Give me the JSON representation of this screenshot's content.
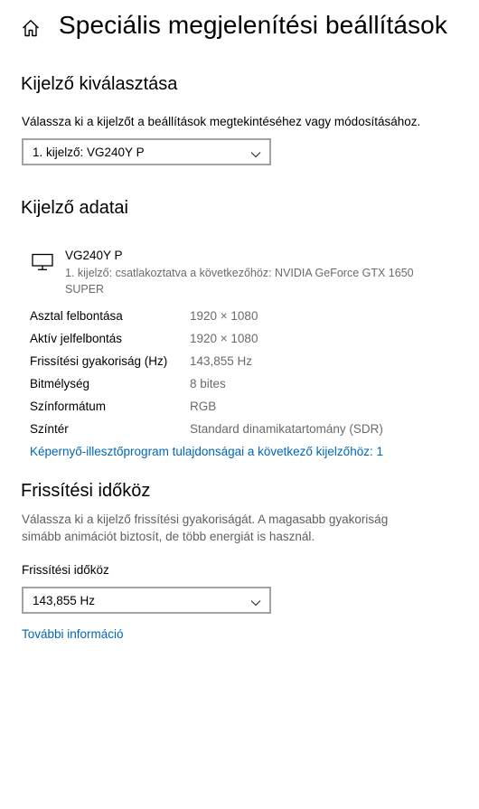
{
  "header": {
    "title": "Speciális megjelenítési beállítások",
    "home_icon": "home-icon"
  },
  "choose_display": {
    "heading": "Kijelző kiválasztása",
    "description": "Válassza ki a kijelzőt a beállítások megtekintéséhez vagy módosításához.",
    "selected": "1. kijelző: VG240Y P"
  },
  "display_info": {
    "heading": "Kijelző adatai",
    "device_icon": "monitor-icon",
    "device_name": "VG240Y P",
    "device_description": "1. kijelző: csatlakoztatva a következőhöz: NVIDIA GeForce GTX 1650 SUPER",
    "properties": [
      {
        "label": "Asztal felbontása",
        "value": "1920 × 1080"
      },
      {
        "label": "Aktív jelfelbontás",
        "value": "1920 × 1080"
      },
      {
        "label": "Frissítési gyakoriság (Hz)",
        "value": "143,855 Hz"
      },
      {
        "label": "Bitmélység",
        "value": "8 bites"
      },
      {
        "label": "Színformátum",
        "value": "RGB"
      },
      {
        "label": "Színtér",
        "value": "Standard dinamikatartomány (SDR)"
      }
    ],
    "adapter_link": "Képernyő-illesztőprogram tulajdonságai a következő kijelzőhöz: 1"
  },
  "refresh_rate": {
    "heading": "Frissítési időköz",
    "description": "Válassza ki a kijelző frissítési gyakoriságát. A magasabb gyakoriság simább animációt biztosít, de több energiát is használ.",
    "field_label": "Frissítési időköz",
    "selected": "143,855 Hz",
    "more_info_link": "További információ"
  },
  "colors": {
    "link": "#0067b8",
    "muted_text": "#6b6b6b",
    "dropdown_border": "#a3a3a3"
  }
}
